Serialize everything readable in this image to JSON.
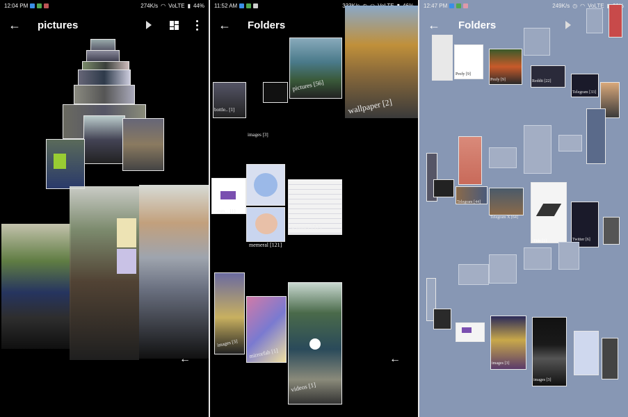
{
  "screens": [
    {
      "status": {
        "time": "12:04 PM",
        "speed": "274K/s",
        "network": "VoLTE",
        "battery": "44%"
      },
      "title": "pictures"
    },
    {
      "status": {
        "time": "11:52 AM",
        "speed": "333K/s",
        "network": "VoLTE",
        "battery": "46%"
      },
      "title": "Folders",
      "folders": [
        "pictures [56]",
        "wallpaper [2]",
        "bottle.. [1]",
        "images [3]",
        "comm... [1]",
        "memeral [121]",
        "scanner [12]",
        "images [3]",
        "mirrorfab [1]",
        "videos [1]"
      ]
    },
    {
      "status": {
        "time": "12:47 PM",
        "speed": "249K/s",
        "network": "VoLTE",
        "battery": "39%"
      },
      "title": "Folders",
      "folders": [
        "Profy [9]",
        "Reddit [22]",
        "Telegram [33]",
        "Telegram [44]",
        "Telegram X [64]",
        "Tide [1]",
        "Twitter [6]",
        "images [3]",
        "images [3]"
      ]
    }
  ],
  "icons": {
    "back": "arrow-left-icon",
    "slideshow": "play-icon",
    "view": "grid-view-icon",
    "more": "more-vert-icon"
  }
}
